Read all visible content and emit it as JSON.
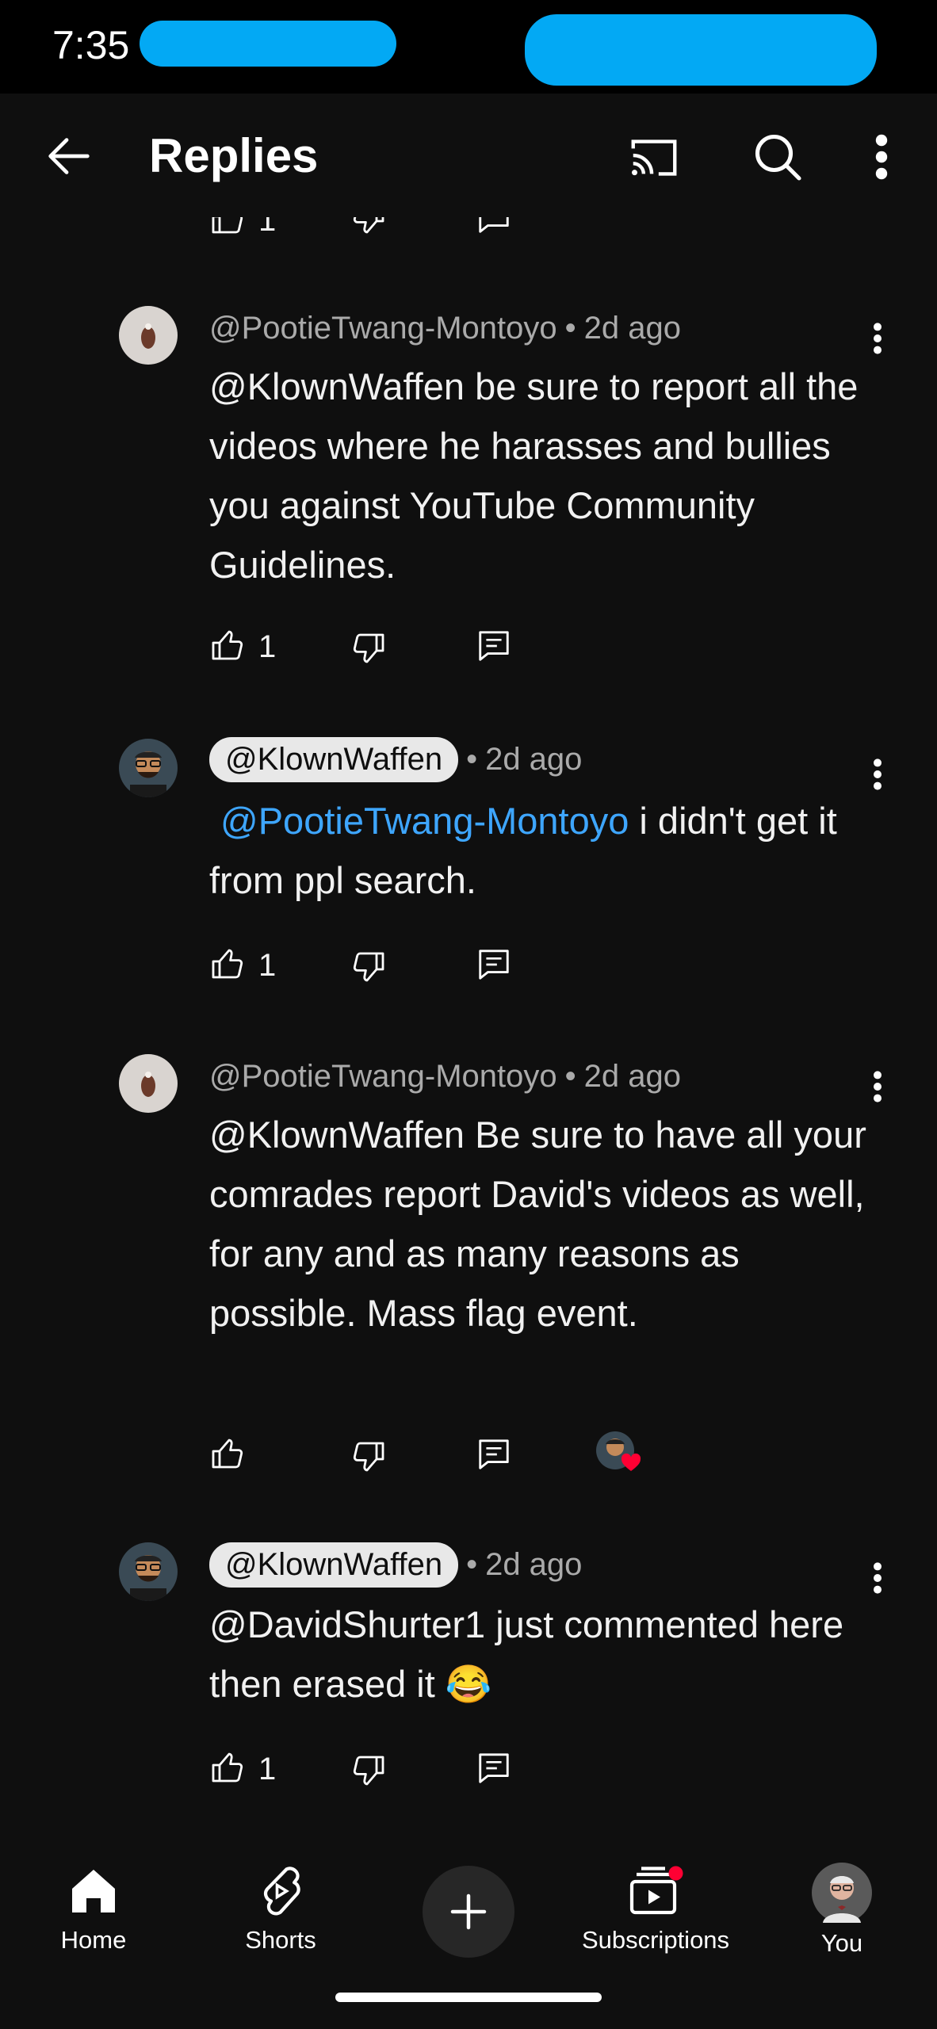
{
  "status_bar": {
    "time": "7:35"
  },
  "app_bar": {
    "title": "Replies"
  },
  "partial_row": {
    "like_count": "1"
  },
  "comments": [
    {
      "author": "@PootieTwang-Montoyo",
      "time": "2d ago",
      "is_highlighted_author": false,
      "mention": "@KlownWaffen",
      "text": " be sure to report all the videos where he harasses and bullies you against YouTube Community Guidelines.",
      "like_count": "1"
    },
    {
      "author": "@KlownWaffen",
      "time": "2d ago",
      "is_highlighted_author": true,
      "mention": "@PootieTwang-Montoyo",
      "text": " i didn't get it from ppl search.",
      "like_count": "1"
    },
    {
      "author": "@PootieTwang-Montoyo",
      "time": "2d ago",
      "is_highlighted_author": false,
      "mention": "@KlownWaffen",
      "text": " Be sure to have all your comrades report David's videos as well, for any and as many reasons as possible. Mass flag event.",
      "like_count": "",
      "creator_heart": true
    },
    {
      "author": "@KlownWaffen",
      "time": "2d ago",
      "is_highlighted_author": true,
      "mention": "@DavidShurter1",
      "text": " just commented here then erased it 😂",
      "like_count": "1"
    }
  ],
  "bottom_nav": {
    "home": "Home",
    "shorts": "Shorts",
    "subscriptions": "Subscriptions",
    "you": "You"
  },
  "colors": {
    "background": "#0f0f0f",
    "mention": "#3ea6ff",
    "redaction": "#03a9f4",
    "heart": "#ff0033"
  }
}
